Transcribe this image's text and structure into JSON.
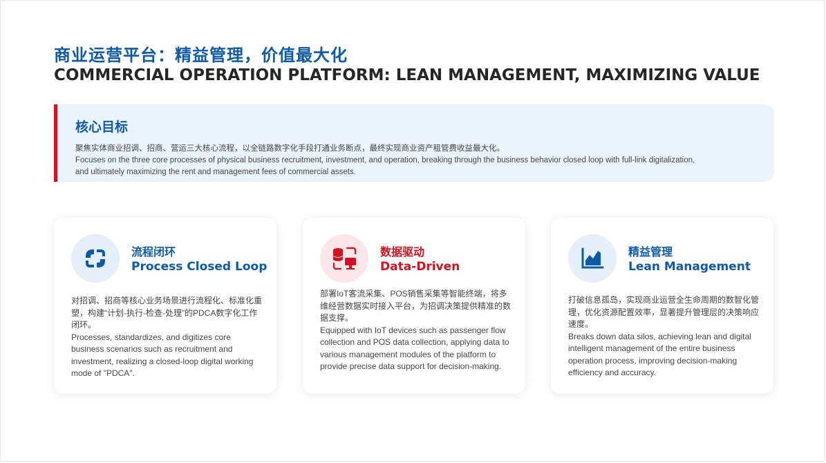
{
  "header": {
    "title_zh": "商业运营平台：精益管理，价值最大化",
    "title_en": "COMMERCIAL OPERATION PLATFORM: LEAN MANAGEMENT, MAXIMIZING VALUE"
  },
  "core": {
    "title": "核心目标",
    "line1": "聚焦实体商业招调、招商、营运三大核心流程，以全链路数字化手段打通业务断点，最终实现商业资产租管费收益最大化。",
    "line2": "Focuses on the three core processes of physical business recruitment, investment, and operation, breaking through the business behavior closed loop with full-link digitalization,",
    "line3": "and ultimately maximizing the rent and management fees of commercial assets."
  },
  "cards": [
    {
      "icon": "process-loop-icon",
      "title_zh": "流程闭环",
      "title_en": "Process Closed Loop",
      "desc_zh": "对招调、招商等核心业务场景进行流程化、标准化重塑，构建“计划-执行-检查-处理”的PDCA数字化工作闭环。",
      "desc_en": "Processes, standardizes, and digitizes core business scenarios such as recruitment and investment, realizing a closed-loop digital working mode of \"PDCA\"."
    },
    {
      "icon": "data-driven-icon",
      "title_zh": "数据驱动",
      "title_en": "Data-Driven",
      "desc_zh": "部署IoT客流采集、POS销售采集等智能终端，将多维经营数据实时接入平台，为招调决策提供精准的数据支撑。",
      "desc_en": "Equipped with IoT devices such as passenger flow collection and POS data collection, applying data to various management modules of the platform to provide precise data support for decision-making."
    },
    {
      "icon": "lean-chart-icon",
      "title_zh": "精益管理",
      "title_en": "Lean Management",
      "desc_zh": "打破信息孤岛，实现商业运营全生命周期的数智化管理，优化资源配置效率，显著提升管理层的决策响应速度。",
      "desc_en": "Breaks down data silos, achieving lean and digital intelligent management of the entire business operation process, improving decision-making efficiency and accuracy."
    }
  ],
  "colors": {
    "brand_blue": "#0e5aa7",
    "brand_red": "#d7101f",
    "panel_bg": "#eaf4fc"
  }
}
